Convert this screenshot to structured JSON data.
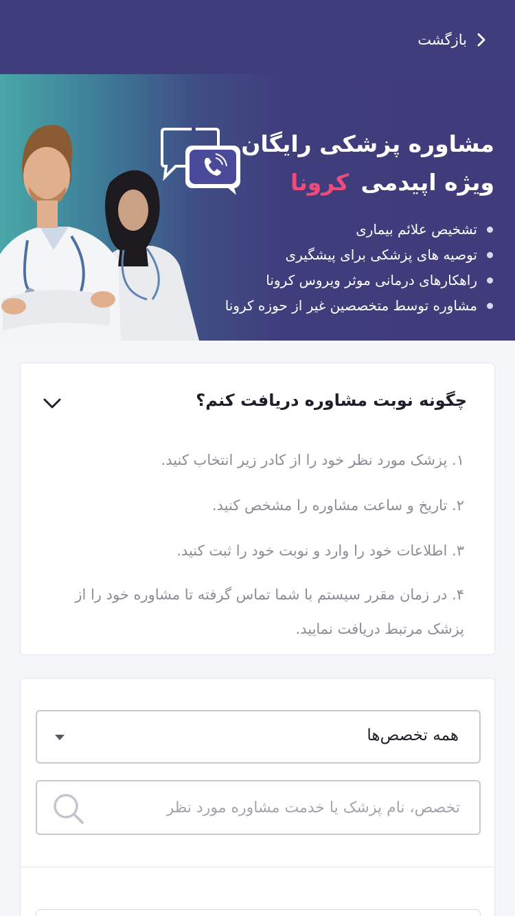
{
  "header": {
    "back_label": "بازگشت",
    "bg_color": "#3f3d7c"
  },
  "banner": {
    "title_line1": "مشاوره پزشکی رایگان",
    "title_line2_prefix": "ویژه اپیدمی",
    "title_line2_highlight": "کرونا",
    "highlight_color": "#f04b7d",
    "bullets": [
      "تشخیص علائم بیماری",
      "توصیه های پزشکی برای پیشگیری",
      "راهکارهای درمانی موثر ویروس کرونا",
      "مشاوره توسط متخصصین غیر از حوزه کرونا"
    ]
  },
  "howto": {
    "title": "چگونه نوبت مشاوره دریافت کنم؟",
    "steps": [
      "۱. پزشک مورد نظر خود را از کادر زیر انتخاب کنید.",
      "۲. تاریخ و ساعت مشاوره را مشخص کنید.",
      "۳. اطلاعات خود را وارد و نوبت خود را ثبت کنید.",
      "۴. در زمان مقرر سیستم با شما تماس گرفته تا مشاوره خود را از پزشک مرتبط دریافت نمایید."
    ]
  },
  "search": {
    "specialty_selected": "همه تخصص‌ها",
    "placeholder": "تخصص، نام پزشک یا خدمت مشاوره مورد نظر"
  }
}
